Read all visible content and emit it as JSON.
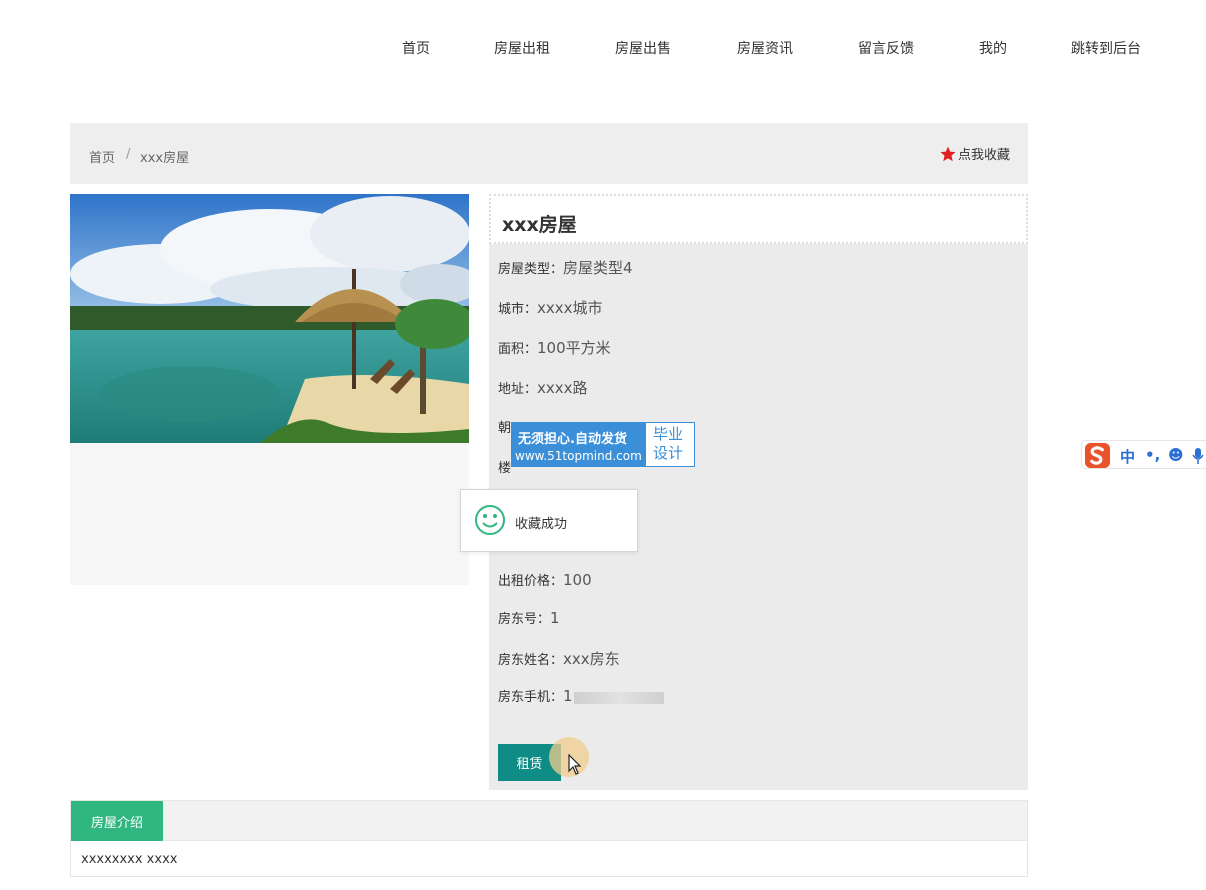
{
  "nav": {
    "items": [
      "首页",
      "房屋出租",
      "房屋出售",
      "房屋资讯",
      "留言反馈",
      "我的",
      "跳转到后台"
    ]
  },
  "breadcrumb": {
    "home": "首页",
    "separator": "/",
    "current": "xxx房屋",
    "favorite_label": "点我收藏"
  },
  "photo": {
    "alt": "beach hut"
  },
  "detail": {
    "title": "xxx房屋",
    "fields": [
      {
        "label": "房屋类型：",
        "value": "房屋类型4"
      },
      {
        "label": "城市：",
        "value": "xxxx城市"
      },
      {
        "label": "面积：",
        "value": "100平方米"
      },
      {
        "label": "地址：",
        "value": "xxxx路"
      },
      {
        "label": "朝",
        "value": ""
      },
      {
        "label": "楼",
        "value": ""
      },
      {
        "label": "出租价格：",
        "value": "100"
      },
      {
        "label": "房东号：",
        "value": "1"
      },
      {
        "label": "房东姓名：",
        "value": "xxx房东"
      },
      {
        "label": "房东手机：",
        "value": "1"
      }
    ],
    "rent_button": "租赁"
  },
  "watermark": {
    "line1": "无须担心.自动发货",
    "line2": "www.51topmind.com",
    "right": "毕业设计"
  },
  "toast": {
    "message": "收藏成功"
  },
  "intro": {
    "tab": "房屋介绍",
    "content": "xxxxxxxx xxxx"
  },
  "ime": {
    "items": [
      "中",
      "•,",
      "☻"
    ]
  },
  "colors": {
    "rent_button": "#0f8c86",
    "intro_tab": "#2fb77f",
    "star": "#e02020",
    "watermark": "#3a8fd8"
  }
}
